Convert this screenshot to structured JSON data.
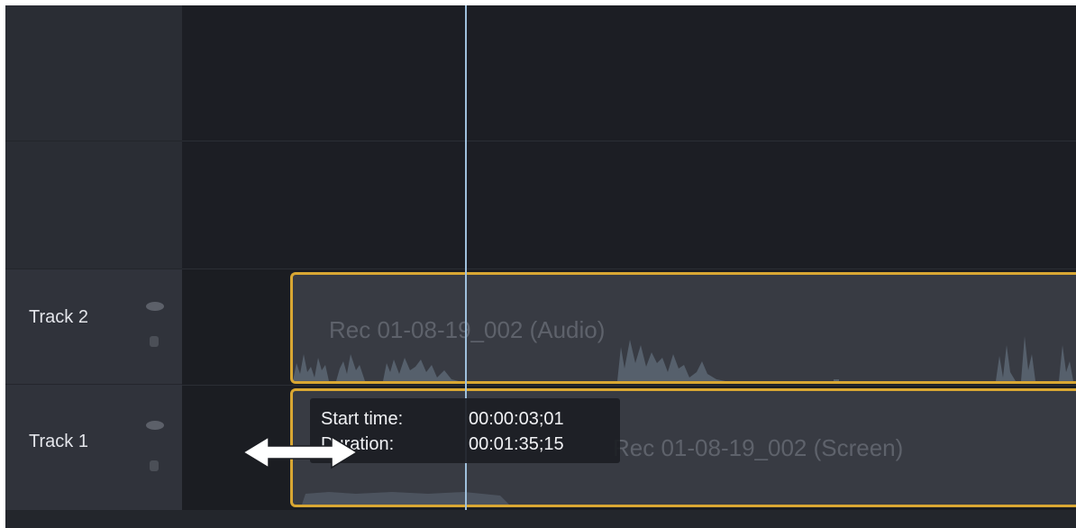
{
  "tracks": [
    {
      "name": "Track 2"
    },
    {
      "name": "Track 1"
    }
  ],
  "clips": {
    "audio_title": "Rec 01-08-19_002 (Audio)",
    "screen_title": "Rec 01-08-19_002 (Screen)"
  },
  "tooltip": {
    "start_label": "Start time:",
    "start_value": "00:00:03;01",
    "duration_label": "Duration:",
    "duration_value": "00:01:35;15"
  },
  "icons": {
    "visibility": "eye-icon",
    "lock": "lock-icon",
    "cursor": "horizontal-resize-cursor-icon"
  },
  "colors": {
    "clip_border": "#d9a733",
    "playhead": "#9fc0dc",
    "background": "#1b1d22"
  }
}
